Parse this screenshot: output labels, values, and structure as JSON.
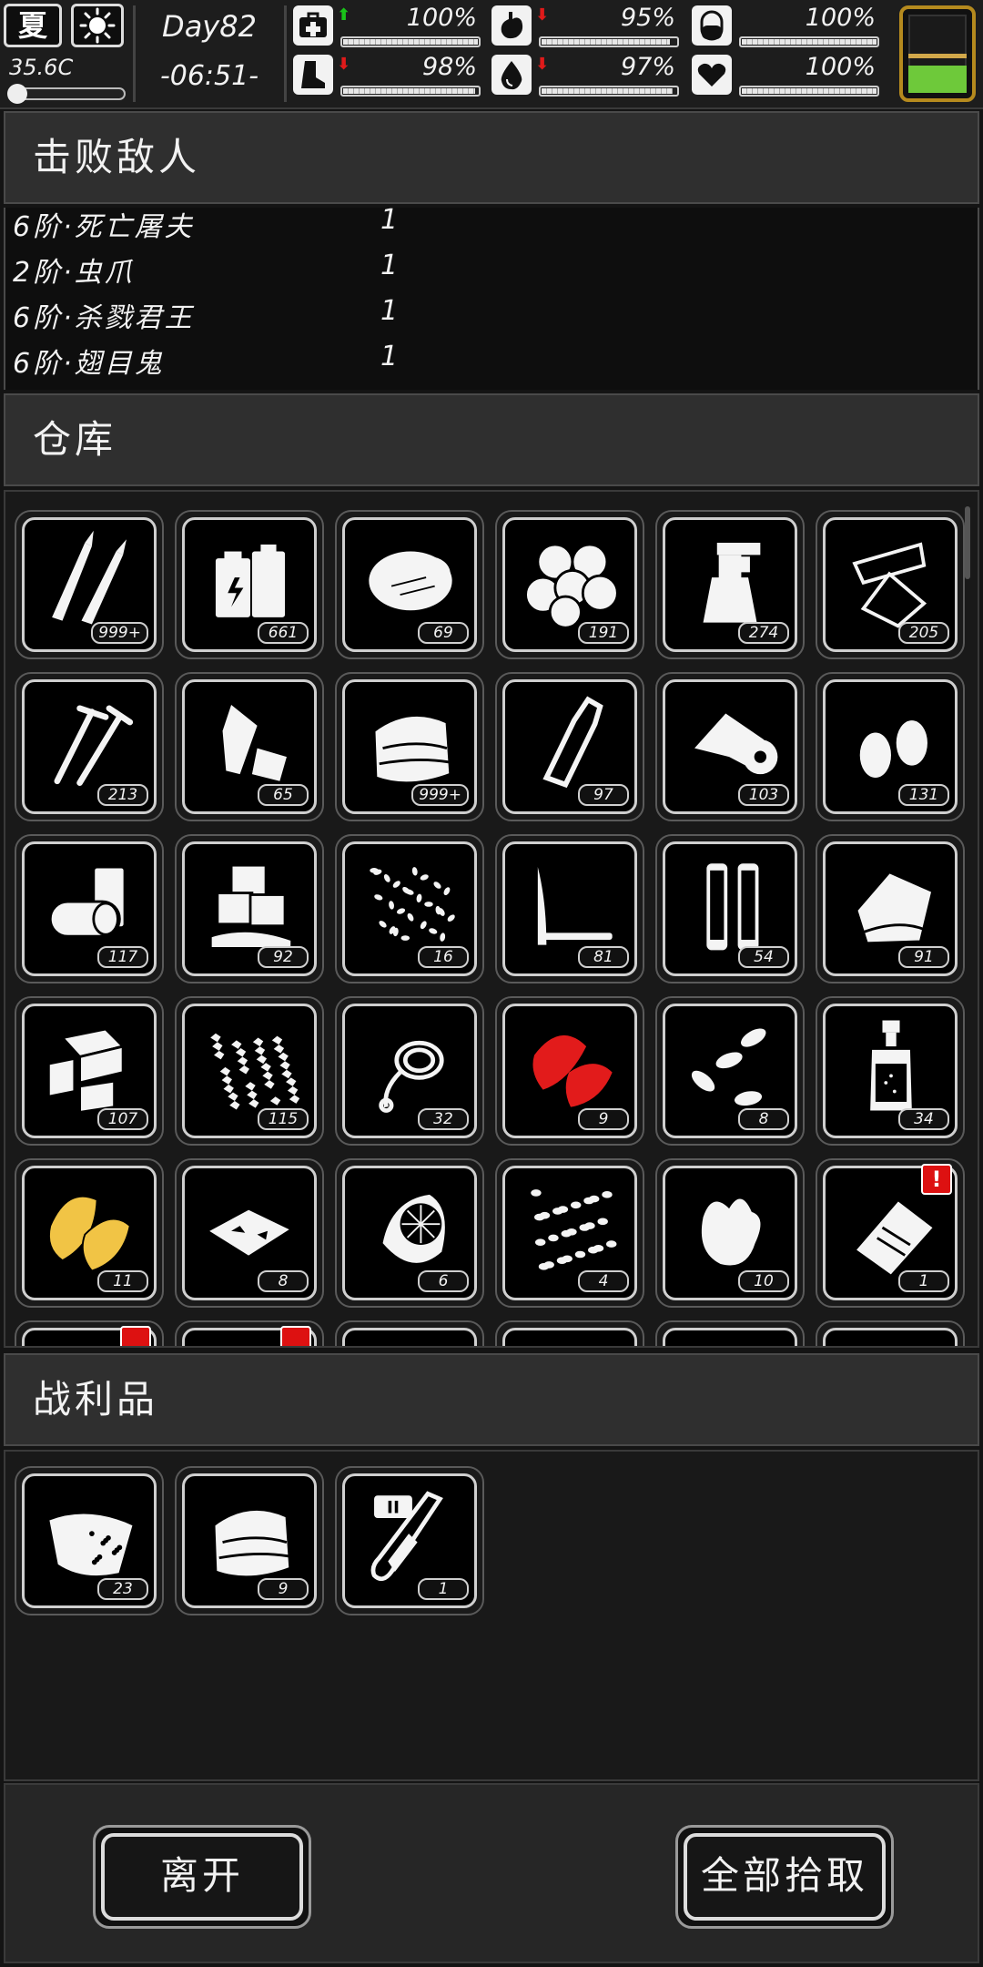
{
  "status": {
    "season": "夏",
    "weather_icon": "sun-icon",
    "temperature": "35.6C",
    "temperature_level": 0.12,
    "day": "Day82",
    "time": "-06:51-",
    "stats": [
      {
        "name": "health",
        "icon": "medkit-icon",
        "trend": "up",
        "value": "100%",
        "level": 1.0
      },
      {
        "name": "hunger",
        "icon": "stomach-icon",
        "trend": "down",
        "value": "95%",
        "level": 0.95
      },
      {
        "name": "medicine",
        "icon": "pill-icon",
        "trend": "",
        "value": "100%",
        "level": 1.0
      },
      {
        "name": "stamina",
        "icon": "boot-icon",
        "trend": "down",
        "value": "98%",
        "level": 0.98
      },
      {
        "name": "thirst",
        "icon": "water-drop-icon",
        "trend": "down",
        "value": "97%",
        "level": 0.97
      },
      {
        "name": "mood",
        "icon": "heart-icon",
        "trend": "",
        "value": "100%",
        "level": 1.0
      }
    ],
    "battery_level": 0.25,
    "colors": {
      "up": "#19c419",
      "down": "#e01a1a",
      "battery": "#6ec93a",
      "battery_frame": "#b58a1e"
    }
  },
  "enemies": {
    "title": "击败敌人",
    "rows": [
      {
        "name": "6阶·死亡屠夫",
        "count": "1"
      },
      {
        "name": "2阶·虫爪",
        "count": "1"
      },
      {
        "name": "6阶·杀戮君王",
        "count": "1"
      },
      {
        "name": "6阶·翅目鬼",
        "count": "1"
      }
    ]
  },
  "storage": {
    "title": "仓库",
    "items": [
      {
        "icon": "bullets-icon",
        "qty": "999+"
      },
      {
        "icon": "batteries-icon",
        "qty": "661"
      },
      {
        "icon": "cotton-icon",
        "qty": "69"
      },
      {
        "icon": "cotton-balls-icon",
        "qty": "191"
      },
      {
        "icon": "spray-bottle-icon",
        "qty": "274"
      },
      {
        "icon": "glass-shards-icon",
        "qty": "205"
      },
      {
        "icon": "screws-icon",
        "qty": "213"
      },
      {
        "icon": "plastic-bottles-icon",
        "qty": "65"
      },
      {
        "icon": "cloth-icon",
        "qty": "999+"
      },
      {
        "icon": "bottle-icon",
        "qty": "97"
      },
      {
        "icon": "bandage-roll-icon",
        "qty": "103"
      },
      {
        "icon": "earplugs-icon",
        "qty": "131"
      },
      {
        "icon": "cans-icon",
        "qty": "117"
      },
      {
        "icon": "ice-icon",
        "qty": "92"
      },
      {
        "icon": "seeds-icon",
        "qty": "16"
      },
      {
        "icon": "knife-icon",
        "qty": "81"
      },
      {
        "icon": "shell-casings-icon",
        "qty": "54"
      },
      {
        "icon": "towel-icon",
        "qty": "91"
      },
      {
        "icon": "wood-blocks-icon",
        "qty": "107"
      },
      {
        "icon": "gravel-icon",
        "qty": "115"
      },
      {
        "icon": "rope-icon",
        "qty": "32"
      },
      {
        "icon": "red-leaves-icon",
        "qty": "9"
      },
      {
        "icon": "sunflower-seeds-icon",
        "qty": "8"
      },
      {
        "icon": "medicine-bottle-icon",
        "qty": "34"
      },
      {
        "icon": "yellow-leaves-icon",
        "qty": "11"
      },
      {
        "icon": "paper-scraps-icon",
        "qty": "8"
      },
      {
        "icon": "filter-icon",
        "qty": "6"
      },
      {
        "icon": "beans-icon",
        "qty": "4"
      },
      {
        "icon": "ginger-icon",
        "qty": "10"
      },
      {
        "icon": "clipboard-icon",
        "qty": "1",
        "alert": "!"
      }
    ],
    "partial_row_alerts": [
      0,
      1
    ]
  },
  "loot": {
    "title": "战利品",
    "items": [
      {
        "icon": "meat-sack-icon",
        "qty": "23"
      },
      {
        "icon": "cloth-icon",
        "qty": "9"
      },
      {
        "icon": "test-tube-icon",
        "qty": "1",
        "tag": "II"
      }
    ]
  },
  "actions": {
    "leave_label": "离开",
    "take_all_label": "全部拾取"
  }
}
